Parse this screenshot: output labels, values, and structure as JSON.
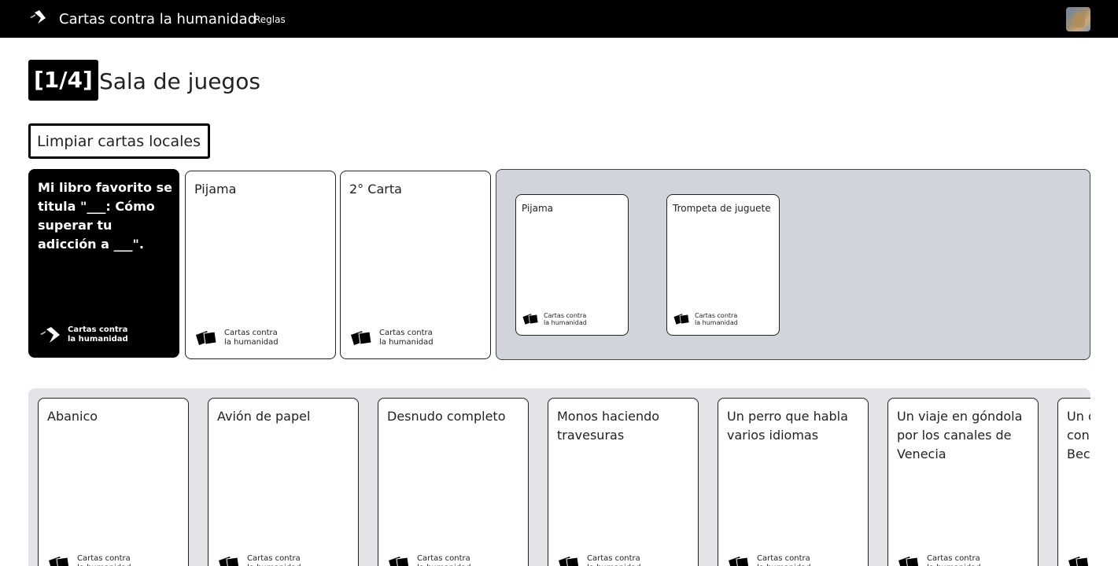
{
  "navbar": {
    "title": "Cartas contra la humanidad",
    "rules_link": "Reglas",
    "brand_icon": "cah-logo-icon",
    "avatar_icon": "user-avatar"
  },
  "header": {
    "counter": "[1/4]",
    "title": "Sala de juegos"
  },
  "clear_button": "Limpiar cartas locales",
  "footer_line1": "Cartas contra",
  "footer_line2": "la humanidad",
  "black_card": {
    "text": "Mi libro favorito se titula \"___: Cómo superar tu adicción a ___\"."
  },
  "selected_cards": [
    {
      "text": "Pijama"
    },
    {
      "text": "2° Carta"
    }
  ],
  "played_cards": [
    {
      "text": "Pijama"
    },
    {
      "text": "Trompeta de juguete"
    }
  ],
  "hand_cards": [
    {
      "text": "Abanico"
    },
    {
      "text": "Avión de papel"
    },
    {
      "text": "Desnudo completo"
    },
    {
      "text": "Monos haciendo travesuras"
    },
    {
      "text": "Un perro que habla varios idiomas"
    },
    {
      "text": "Un viaje en góndola por los canales de Venecia"
    },
    {
      "text": "Un c con Becl"
    }
  ],
  "colors": {
    "navbar": "#000000",
    "black_card": "#000000",
    "played_area": "#d1d5db",
    "hand_area": "#e2e4e8"
  }
}
